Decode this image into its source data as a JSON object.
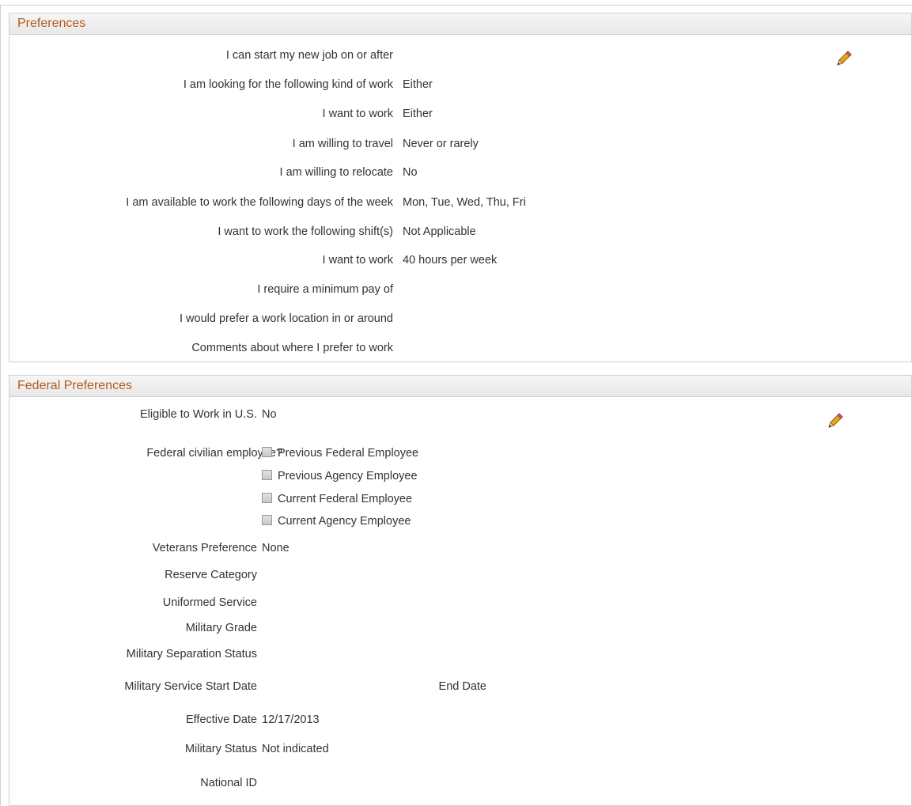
{
  "preferences": {
    "title": "Preferences",
    "edit_icon": "pencil-icon",
    "fields": [
      {
        "label": "I can start my new job on or after",
        "value": ""
      },
      {
        "label": "I am looking for the following kind of work",
        "value": "Either"
      },
      {
        "label": "I want to work",
        "value": "Either"
      },
      {
        "label": "I am willing to travel",
        "value": "Never or rarely"
      },
      {
        "label": "I am willing to relocate",
        "value": "No"
      },
      {
        "label": "I am available to work the following days of the week",
        "value": "Mon, Tue, Wed, Thu, Fri"
      },
      {
        "label": "I want to work the following shift(s)",
        "value": "Not Applicable"
      },
      {
        "label": "I want to work",
        "value": "40 hours per week"
      },
      {
        "label": "I require a minimum pay of",
        "value": ""
      },
      {
        "label": "I would prefer a work location in or around",
        "value": ""
      },
      {
        "label": "Comments about where I prefer to work",
        "value": ""
      }
    ]
  },
  "federal": {
    "title": "Federal Preferences",
    "edit_icon": "pencil-icon",
    "eligible": {
      "label": "Eligible to Work in U.S.",
      "value": "No"
    },
    "civilian_label": "Federal civilian employee?",
    "checkboxes": [
      {
        "label": "Previous Federal Employee",
        "checked": false
      },
      {
        "label": "Previous Agency Employee",
        "checked": false
      },
      {
        "label": "Current Federal Employee",
        "checked": false
      },
      {
        "label": "Current Agency Employee",
        "checked": false
      }
    ],
    "veterans": {
      "label": "Veterans Preference",
      "value": "None"
    },
    "reserve": {
      "label": "Reserve Category",
      "value": ""
    },
    "uniformed": {
      "label": "Uniformed Service",
      "value": ""
    },
    "grade": {
      "label": "Military Grade",
      "value": ""
    },
    "separation": {
      "label": "Military Separation Status",
      "value": ""
    },
    "service_start": {
      "label": "Military Service Start Date",
      "value": ""
    },
    "end_date": {
      "label": "End Date",
      "value": ""
    },
    "effective": {
      "label": "Effective Date",
      "value": "12/17/2013"
    },
    "military_status": {
      "label": "Military Status",
      "value": "Not indicated"
    },
    "national_id": {
      "label": "National ID",
      "value": ""
    }
  },
  "colors": {
    "header_text": "#b35a1a",
    "border": "#d0d0d0",
    "pencil": "#e0a020"
  }
}
